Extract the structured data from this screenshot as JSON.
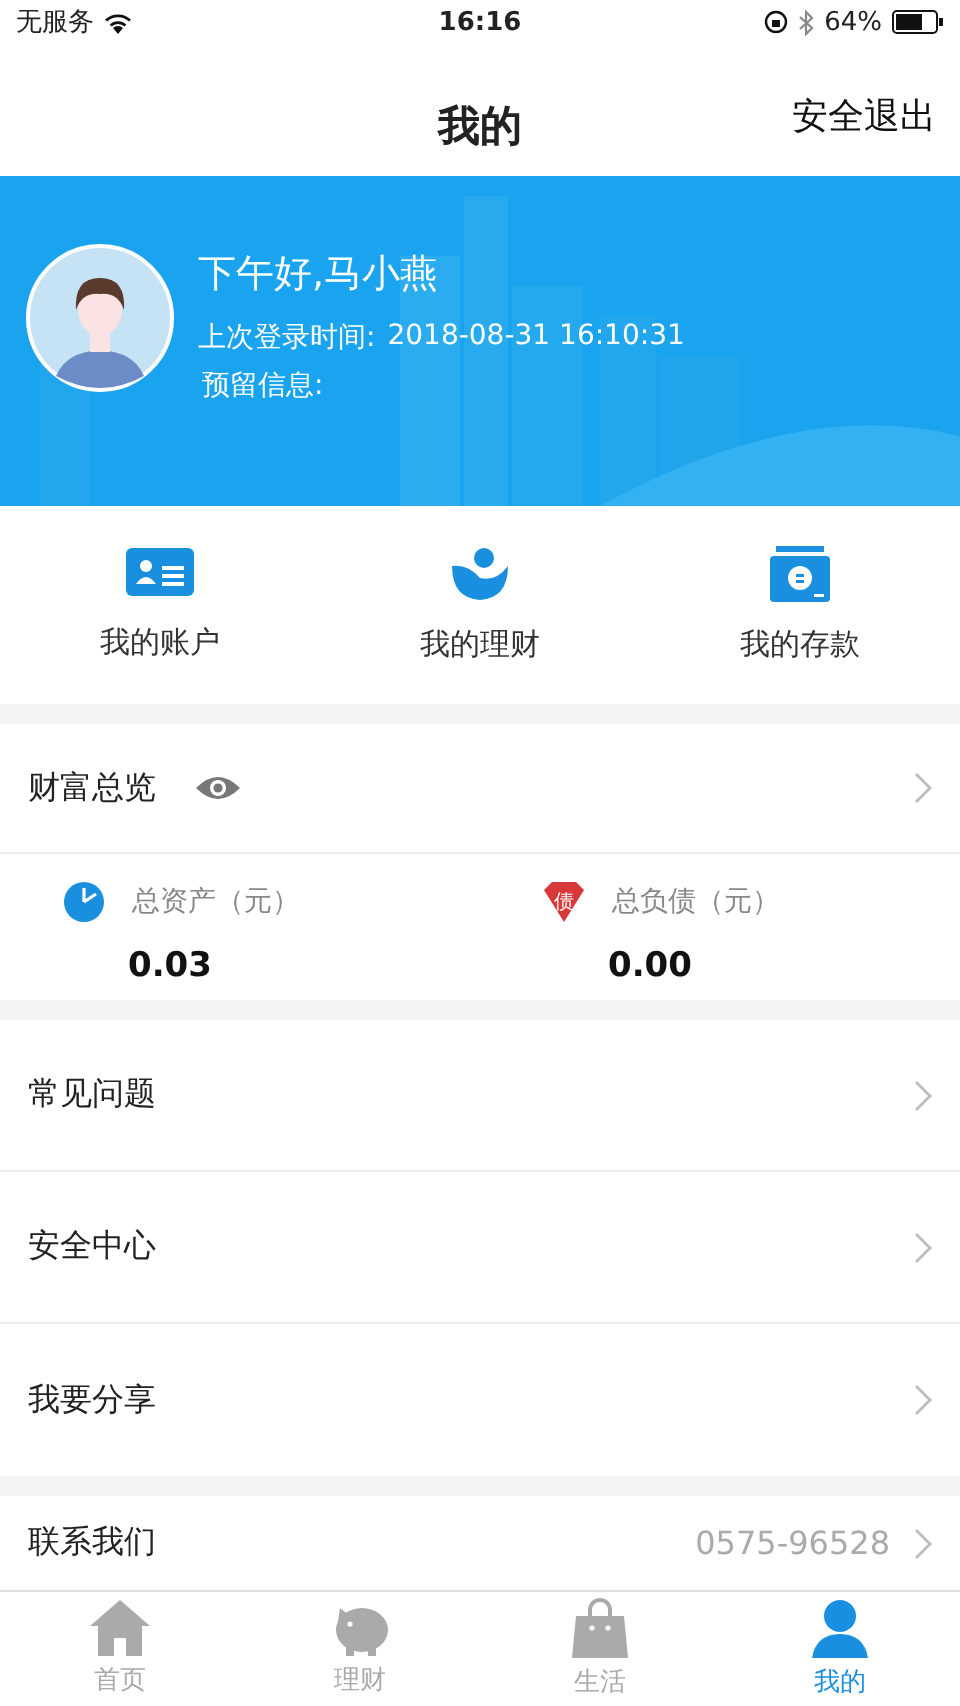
{
  "status_bar": {
    "carrier": "无服务",
    "time": "16:16",
    "battery": "64%"
  },
  "nav": {
    "title": "我的",
    "action": "安全退出"
  },
  "profile": {
    "greeting": "下午好,马小燕",
    "last_login_label": "上次登录时间:",
    "last_login": "2018-08-31 16:10:31",
    "reserved_label": "预留信息:"
  },
  "shortcuts": [
    {
      "kind": "account",
      "label": "我的账户"
    },
    {
      "kind": "finance",
      "label": "我的理财"
    },
    {
      "kind": "deposit",
      "label": "我的存款"
    }
  ],
  "wealth": {
    "title": "财富总览",
    "stats": [
      {
        "kind": "assets",
        "label": "总资产（元）",
        "value": "0.03"
      },
      {
        "kind": "debt",
        "icon_text": "债",
        "label": "总负债（元）",
        "value": "0.00"
      }
    ]
  },
  "menu": [
    {
      "label": "常见问题"
    },
    {
      "label": "安全中心"
    },
    {
      "label": "我要分享"
    }
  ],
  "contact": {
    "label": "联系我们",
    "phone": "0575-96528"
  },
  "tabs": [
    {
      "kind": "home",
      "label": "首页",
      "selected": false
    },
    {
      "kind": "piggy",
      "label": "理财",
      "selected": false
    },
    {
      "kind": "bag",
      "label": "生活",
      "selected": false
    },
    {
      "kind": "person",
      "label": "我的",
      "selected": true
    }
  ]
}
